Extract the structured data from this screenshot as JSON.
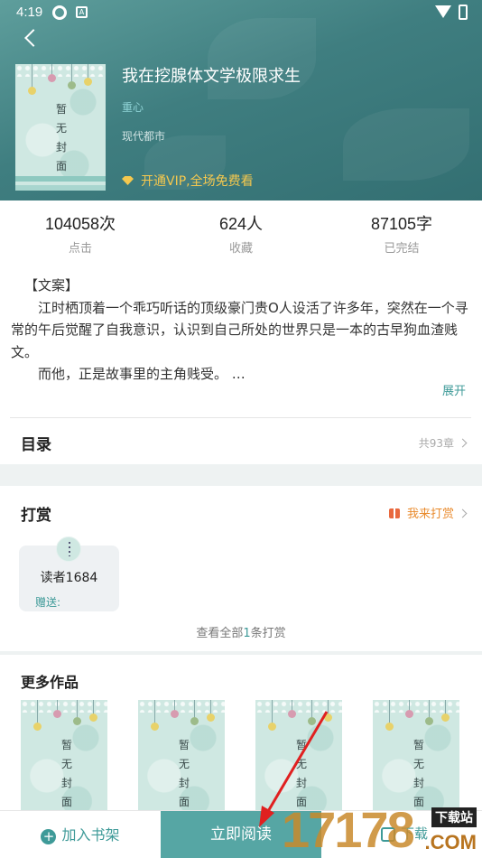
{
  "status_bar": {
    "time": "4:19",
    "icon_a": "A"
  },
  "book": {
    "title": "我在挖腺体文学极限求生",
    "author": "重心",
    "genre": "现代都市",
    "vip_text": "开通VIP,全场免费看",
    "cover_text": [
      "暂",
      "无",
      "封",
      "面"
    ]
  },
  "stats": [
    {
      "value": "104058次",
      "label": "点击"
    },
    {
      "value": "624人",
      "label": "收藏"
    },
    {
      "value": "87105字",
      "label": "已完结"
    }
  ],
  "intro": {
    "heading": "【文案】",
    "paragraphs": [
      "江时栖顶着一个乖巧听话的顶级豪门贵O人设活了许多年，突然在一个寻常的午后觉醒了自我意识，认识到自己所处的世界只是一本的古早狗血渣贱文。",
      "而他，正是故事里的主角贱受。 …"
    ],
    "expand_label": "展开"
  },
  "toc": {
    "title": "目录",
    "count": "共93章"
  },
  "tips": {
    "title": "打赏",
    "action": "我来打赏",
    "tipper_name": "读者1684",
    "gift_label": "赠送:",
    "view_all_prefix": "查看全部",
    "view_all_count": "1",
    "view_all_suffix": "条打赏"
  },
  "more_works": {
    "title": "更多作品"
  },
  "bottom_bar": {
    "add_shelf": "加入书架",
    "read_now": "立即阅读",
    "third_label": "下载"
  },
  "watermark": {
    "big": "17178",
    "badge": "下载站",
    "suffix": ".COM"
  },
  "colors": {
    "accent": "#3e9a98",
    "header": "#3f7e80",
    "vip": "#f5c84e",
    "tip_action": "#e98a2c",
    "arrow": "#e02020"
  }
}
